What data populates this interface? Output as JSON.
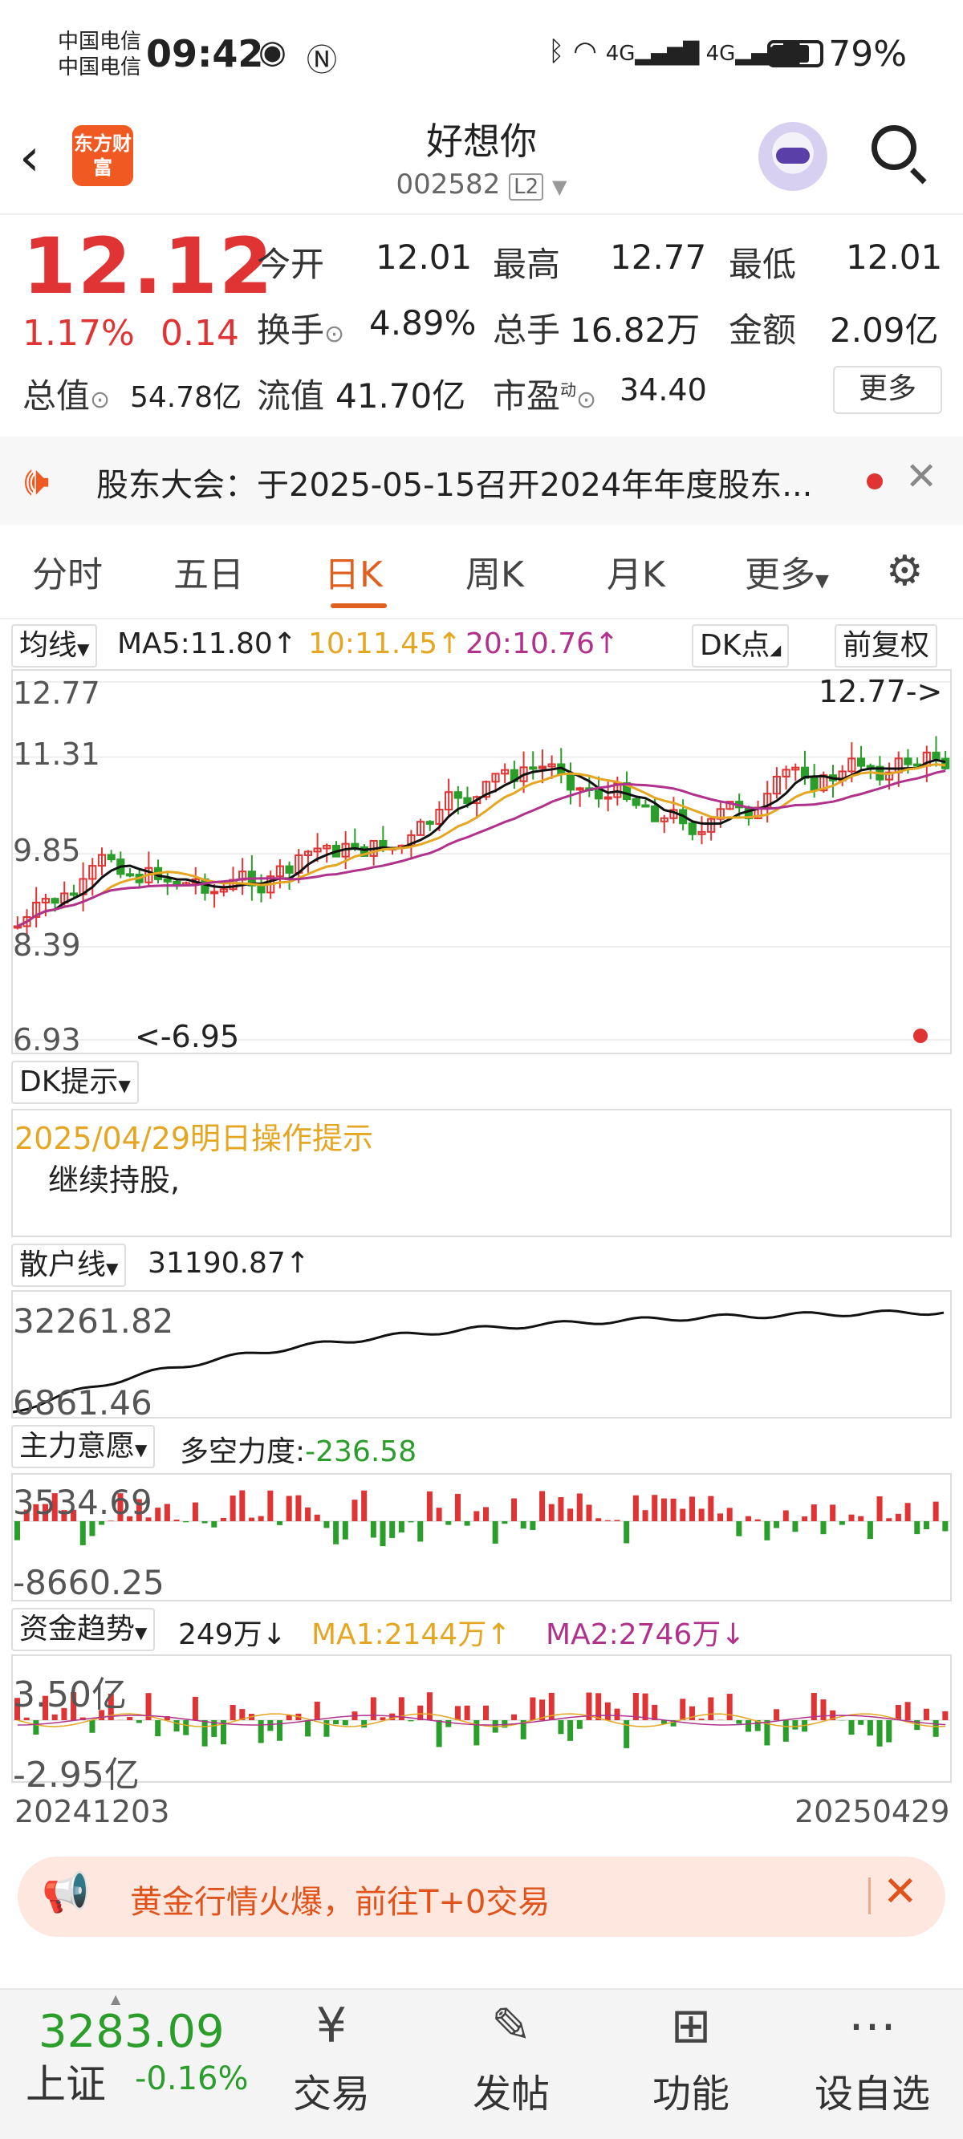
{
  "status_bar": {
    "carrier1": "中国电信",
    "carrier2": "中国电信",
    "time": "09:42",
    "icons": "⚭ ⁶ᵀ 4G 4G",
    "battery": "79%"
  },
  "header": {
    "logo_text": "东方财富",
    "stock_name": "好想你",
    "stock_code": "002582",
    "level": "L2"
  },
  "quote": {
    "price": "12.12",
    "change_pct": "1.17%",
    "change_abs": "0.14",
    "open_label": "今开",
    "open": "12.01",
    "high_label": "最高",
    "high": "12.77",
    "low_label": "最低",
    "low": "12.01",
    "turnover_label": "换手",
    "turnover": "4.89%",
    "volume_label": "总手",
    "volume": "16.82万",
    "amount_label": "金额",
    "amount": "2.09亿",
    "mktcap_label": "总值",
    "mktcap": "54.78亿",
    "float_label": "流值",
    "float": "41.70亿",
    "pe_label": "市盈",
    "pe_sup": "动",
    "pe": "34.40",
    "more": "更多"
  },
  "notice": {
    "text": "股东大会：于2025-05-15召开2024年年度股东..."
  },
  "tabs": [
    "分时",
    "五日",
    "日K",
    "周K",
    "月K",
    "更多"
  ],
  "kline": {
    "ma_select": "均线",
    "ma5": "MA5:11.80↑",
    "ma10": "10:11.45↑",
    "ma20": "20:10.76↑",
    "dk_button": "DK点",
    "adjust_button": "前复权",
    "y_labels": [
      "12.77",
      "11.31",
      "9.85",
      "8.39",
      "6.93"
    ],
    "high_marker": "12.77->",
    "low_marker": "<-6.95"
  },
  "dk_hint": {
    "select": "DK提示",
    "date_line": "2025/04/29明日操作提示",
    "advice": "继续持股,"
  },
  "retail_line": {
    "select": "散户线",
    "value": "31190.87↑",
    "y_top": "32261.82",
    "y_bottom": "6861.46"
  },
  "main_force": {
    "select": "主力意愿",
    "label": "多空力度:",
    "value": "-236.58",
    "y_top": "3534.69",
    "y_bottom": "-8660.25"
  },
  "fund_trend": {
    "select": "资金趋势",
    "value": "249万↓",
    "ma1": "MA1:2144万↑",
    "ma2": "MA2:2746万↓",
    "y_top": "3.50亿",
    "y_bottom": "-2.95亿",
    "date_start": "20241203",
    "date_end": "20250429"
  },
  "banner": {
    "text": "黄金行情火爆，前往T+0交易"
  },
  "bottom_bar": {
    "index_price": "3283.09",
    "index_name": "上证",
    "index_change": "-0.16%",
    "items": [
      {
        "label": "交易",
        "icon": "¥"
      },
      {
        "label": "发帖",
        "icon": "✎"
      },
      {
        "label": "功能",
        "icon": "⊞"
      },
      {
        "label": "设自选",
        "icon": "⋯"
      }
    ]
  },
  "colors": {
    "up": "#e03434",
    "down": "#2a9d2a",
    "ma5": "#111111",
    "ma10": "#e5a622",
    "ma20": "#b0328c",
    "accent": "#f05a22"
  }
}
